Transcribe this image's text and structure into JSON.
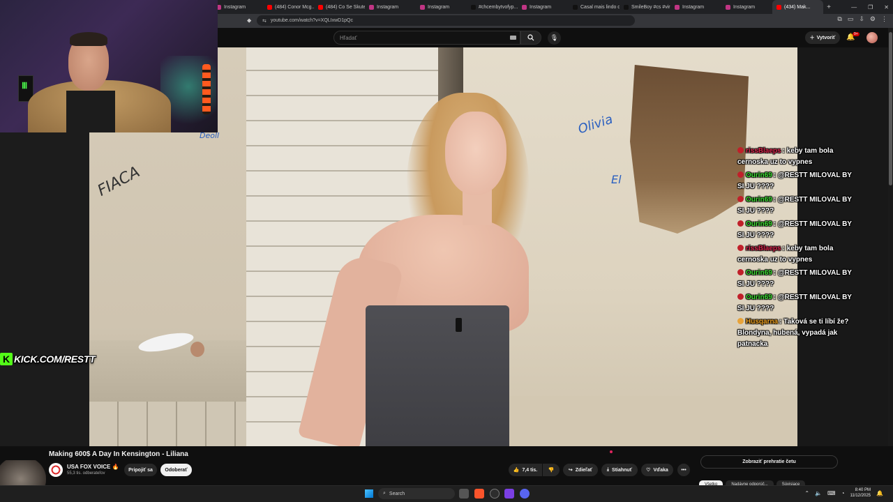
{
  "browser": {
    "tabs": [
      {
        "label": "Instagram",
        "color": "#c13584"
      },
      {
        "label": "(484) Conor Mcg...",
        "color": "#ff0000"
      },
      {
        "label": "(484) Co Se Skuteč...",
        "color": "#ff0000"
      },
      {
        "label": "Instagram",
        "color": "#c13584"
      },
      {
        "label": "Instagram",
        "color": "#c13584"
      },
      {
        "label": "#chcembytvofyp...",
        "color": "#111111"
      },
      {
        "label": "Instagram",
        "color": "#c13584"
      },
      {
        "label": "Casal mais lindo d...",
        "color": "#111111"
      },
      {
        "label": "SmileBoy #cs #vira...",
        "color": "#111111"
      },
      {
        "label": "Instagram",
        "color": "#c13584"
      },
      {
        "label": "Instagram",
        "color": "#c13584"
      },
      {
        "label": "(434) Mak...",
        "color": "#ff0000",
        "active": true
      }
    ],
    "new_tab": "+",
    "url": "youtube.com/watch?v=XQLIxwD1pQc",
    "window_controls": [
      "—",
      "❐",
      "✕"
    ]
  },
  "youtube": {
    "search_placeholder": "Hľadať",
    "create_label": "Vytvoriť",
    "notif_count": "9+",
    "video_title": "Making 600$ A Day In Kensington - Liliana",
    "channel_name": "USA FOX VOICE",
    "channel_subs": "55,3 tis. odberateľov",
    "join_label": "Pripojiť sa",
    "subscribe_label": "Odoberať",
    "like_count": "7,4 tis.",
    "share_label": "Zdieľať",
    "download_label": "Stiahnuť",
    "thanks_label": "Vďaka",
    "more_label": "•••",
    "replay_chat_label": "Zobraziť prehratie četu",
    "chips": [
      "Všetko",
      "Nadávne odporúč...",
      "Súvisiace"
    ]
  },
  "overlay": {
    "kick_letter": "K",
    "kick_text": "KICK.COM/RESTT",
    "graffiti": [
      "Deoll",
      "FIACA",
      "Olivia",
      "El"
    ],
    "chat": [
      {
        "user": "rissBlaeps",
        "color": "#e02850",
        "badge": "#c0202a",
        "text": ": keby tam bola cernoska uz to vypnes"
      },
      {
        "user": "Ourin69",
        "color": "#3fe034",
        "badge": "#c0202a",
        "text": ": @RESTT MILOVAL BY SI JU ????"
      },
      {
        "user": "Ourin69",
        "color": "#3fe034",
        "badge": "#c0202a",
        "text": ": @RESTT MILOVAL BY SI JU ????"
      },
      {
        "user": "Ourin69",
        "color": "#3fe034",
        "badge": "#c0202a",
        "text": ": @RESTT MILOVAL BY SI JU ????"
      },
      {
        "user": "rissBlaeps",
        "color": "#e02850",
        "badge": "#c0202a",
        "text": ": keby tam bola cernoska uz to vypnes"
      },
      {
        "user": "Ourin69",
        "color": "#3fe034",
        "badge": "#c0202a",
        "text": ": @RESTT MILOVAL BY SI JU ????"
      },
      {
        "user": "Ourin69",
        "color": "#3fe034",
        "badge": "#c0202a",
        "text": ": @RESTT MILOVAL BY SI JU ????"
      },
      {
        "user": "Husqarna",
        "color": "#f5a623",
        "badge": "#e8a33a",
        "text": ": Taková se ti líbí že? Blondyna, hubená, vypadá jak patnacka"
      }
    ]
  },
  "taskbar": {
    "search_label": "Search",
    "time": "8:40 PM",
    "date": "11/12/2025"
  }
}
